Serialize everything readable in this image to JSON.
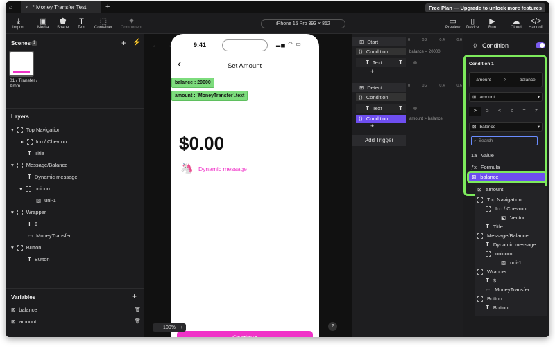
{
  "tab": {
    "title": "* Money Transfer Test"
  },
  "plan": {
    "text": "Free Plan — Upgrade to unlock more features"
  },
  "toolbar": {
    "items": [
      "Import",
      "Media",
      "Shape",
      "Text",
      "Container",
      "Component"
    ],
    "right": [
      "Preview",
      "Device",
      "Run",
      "Cloud",
      "Handoff"
    ],
    "device": "iPhone 15 Pro  393 × 852"
  },
  "scenes": {
    "title": "Scenes",
    "count": "1",
    "name": "01 / Transfer / Amm..."
  },
  "layers": {
    "title": "Layers",
    "items": [
      "Top Navigation",
      "Ico / Chevron",
      "Title",
      "Message/Balance",
      "Dynamic message",
      "unicorn",
      "uni-1",
      "Wrapper",
      "$",
      "MoneyTransfer",
      "Button",
      "Button"
    ]
  },
  "variables": {
    "title": "Variables",
    "items": [
      "balance",
      "amount"
    ]
  },
  "phone": {
    "time": "9:41",
    "title": "Set Amount",
    "tag1": "balance : 20000",
    "tag2": "amount : `MoneyTransfer`.text",
    "amount": "$0.00",
    "message": "Dynamic message",
    "button": "Continue"
  },
  "zoom": {
    "value": "100%",
    "minus": "−",
    "plus": "+",
    "help": "?"
  },
  "logic": {
    "start": "Start",
    "condition": "Condition",
    "text": "Text",
    "detect": "Detect",
    "add_trigger": "Add Trigger",
    "ticks": [
      "0",
      "0.2",
      "0.4",
      "0.6"
    ],
    "note1": "balance = 20000",
    "note2": "amount > balance",
    "plus": "+"
  },
  "right": {
    "title": "Condition",
    "cond_label": "Condition 1",
    "left": "amount",
    "op": ">",
    "rightv": "balance",
    "dd1": "amount",
    "ops": [
      ">",
      "≥",
      "<",
      "≤",
      "=",
      "≠"
    ],
    "dd2": "balance",
    "search": "Search",
    "options": [
      "Value",
      "Formula",
      "balance",
      "amount"
    ],
    "tree": [
      "Top Navigation",
      "Ico / Chevron",
      "Vector",
      "Title",
      "Message/Balance",
      "Dynamic message",
      "unicorn",
      "uni-1",
      "Wrapper",
      "$",
      "MoneyTransfer",
      "Button",
      "Button"
    ]
  },
  "colors": {
    "accent": "#7b5cf0",
    "highlight": "#7dea5c",
    "pink": "#f033c8",
    "tag": "#7ddc7d"
  }
}
